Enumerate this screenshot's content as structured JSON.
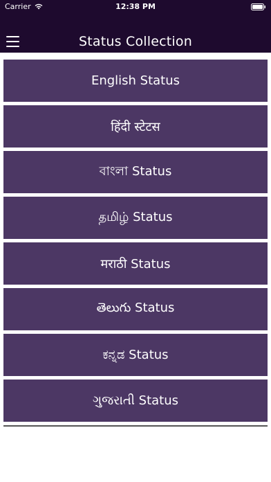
{
  "status_bar": {
    "carrier": "Carrier",
    "time": "12:38 PM"
  },
  "nav": {
    "title": "Status Collection",
    "menu_icon": "hamburger-menu-icon"
  },
  "items": [
    {
      "label": "English Status"
    },
    {
      "label": "हिंदी स्टेटस"
    },
    {
      "label": "বাংলা Status"
    },
    {
      "label": "தமிழ் Status"
    },
    {
      "label": "मराठी Status"
    },
    {
      "label": "తెలుగు Status"
    },
    {
      "label": "ಕನ್ನಡ Status"
    },
    {
      "label": "ગુજરાતી Status"
    }
  ],
  "colors": {
    "nav_background": "#1e0a2e",
    "item_background": "#4c3764",
    "item_text": "#ffffff"
  }
}
